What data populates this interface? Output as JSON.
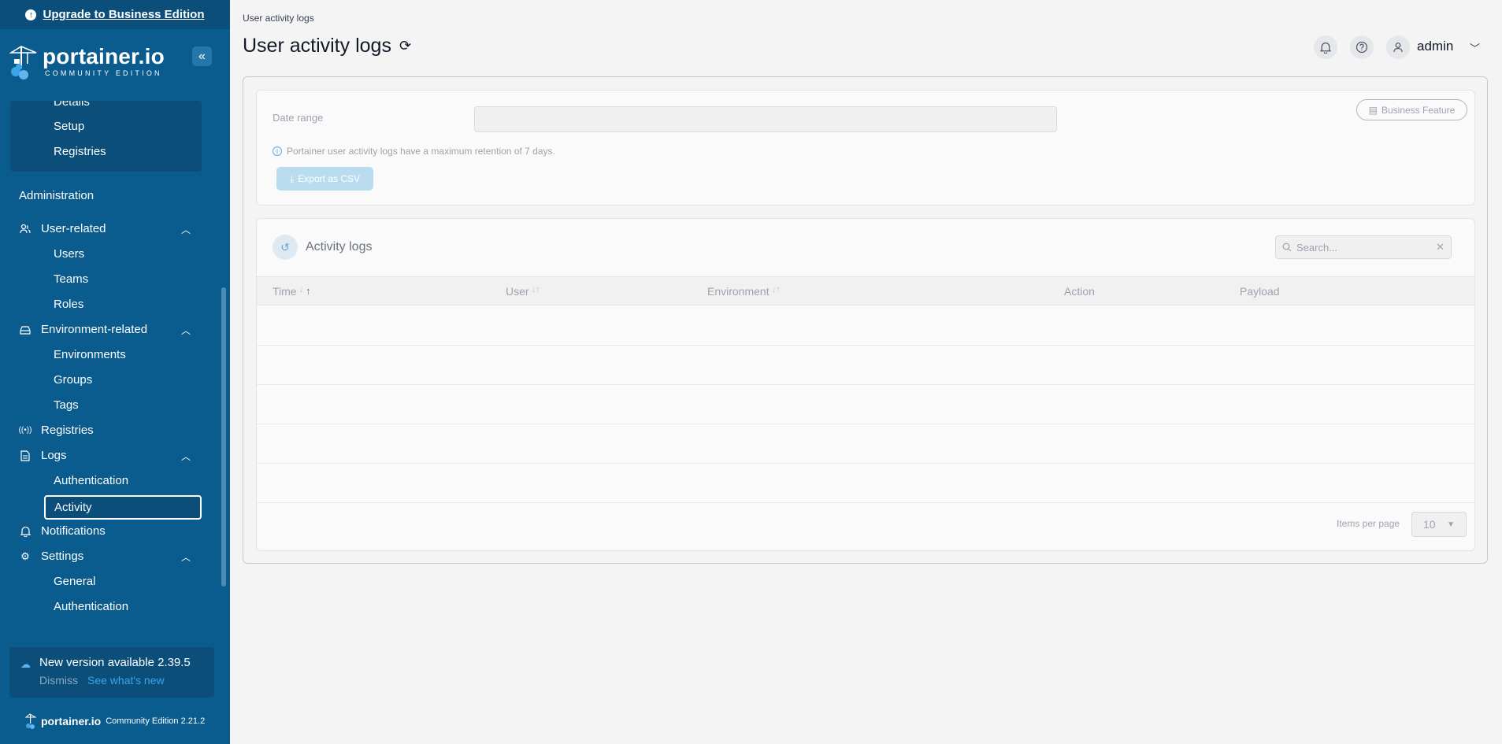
{
  "sidebar": {
    "upgrade_label": "Upgrade to Business Edition",
    "brand_name": "portainer.io",
    "brand_sub": "COMMUNITY EDITION",
    "sub_items": [
      "Details",
      "Setup",
      "Registries"
    ],
    "administration_label": "Administration",
    "user_related": {
      "label": "User-related",
      "items": [
        "Users",
        "Teams",
        "Roles"
      ]
    },
    "environment_related": {
      "label": "Environment-related",
      "items": [
        "Environments",
        "Groups",
        "Tags"
      ]
    },
    "registries_label": "Registries",
    "logs": {
      "label": "Logs",
      "items": [
        "Authentication",
        "Activity"
      ]
    },
    "notifications_label": "Notifications",
    "settings": {
      "label": "Settings",
      "items": [
        "General",
        "Authentication"
      ]
    },
    "update": {
      "title": "New version available 2.39.5",
      "dismiss": "Dismiss",
      "whats_new": "See what's new"
    },
    "footer": {
      "name": "portainer.io",
      "edition": "Community Edition 2.21.2"
    }
  },
  "header": {
    "breadcrumb": "User activity logs",
    "title": "User activity logs",
    "user": "admin"
  },
  "filters": {
    "date_range_label": "Date range",
    "retention_note": "Portainer user activity logs have a maximum retention of 7 days.",
    "export_label": "Export as CSV",
    "business_badge": "Business Feature"
  },
  "table": {
    "title": "Activity logs",
    "search_placeholder": "Search...",
    "columns": [
      "Time",
      "User",
      "Environment",
      "Action",
      "Payload"
    ],
    "items_per_page_label": "Items per page",
    "items_per_page_value": "10"
  },
  "colors": {
    "sidebar": "#0b5c8e",
    "sidebar_dark": "#0a4e79",
    "accent": "#3ba4ea"
  }
}
